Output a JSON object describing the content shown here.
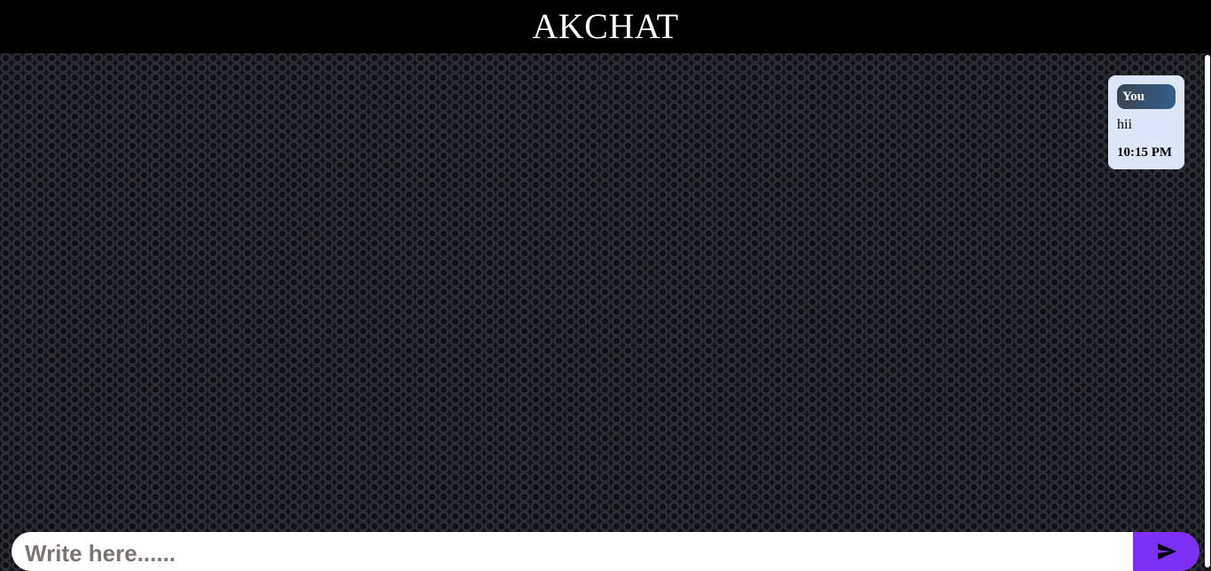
{
  "app": {
    "title": "AKCHAT"
  },
  "messages": [
    {
      "sender": "You",
      "text": "hii",
      "time": "10:15 PM"
    }
  ],
  "composer": {
    "placeholder": "Write here......",
    "value": "",
    "send_icon": "send-icon"
  },
  "colors": {
    "header_bg": "#000000",
    "bubble_bg": "#dde6f6",
    "sender_badge_start": "#3c4450",
    "sender_badge_end": "#335f8c",
    "send_button": "#7b2ff7"
  }
}
